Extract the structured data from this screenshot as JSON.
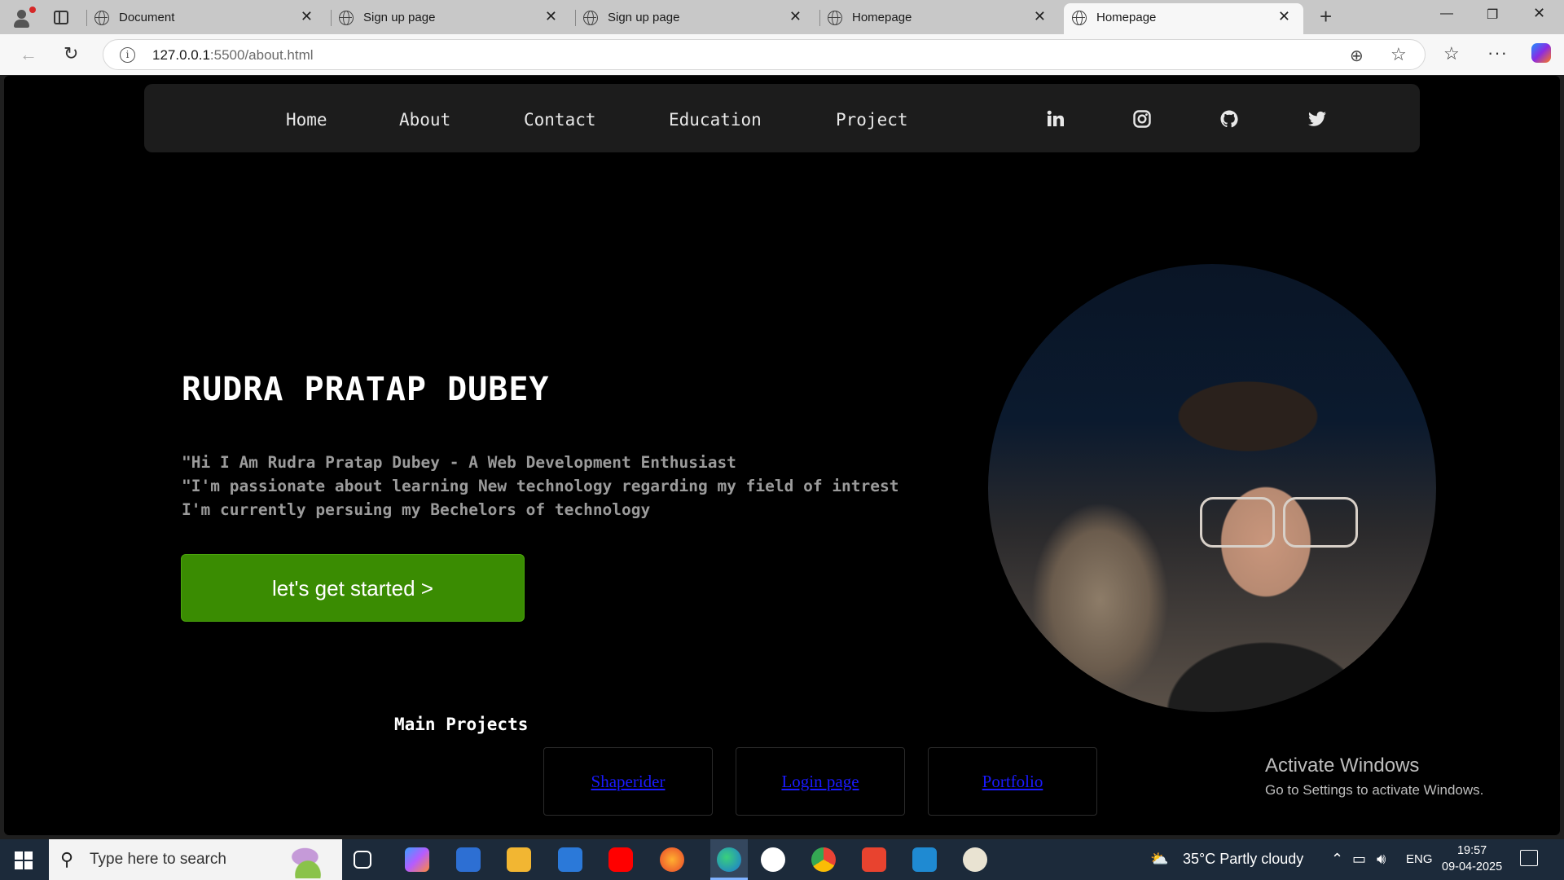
{
  "browser": {
    "tabs": [
      {
        "title": "Document",
        "active": false
      },
      {
        "title": "Sign up page",
        "active": false
      },
      {
        "title": "Sign up page",
        "active": false
      },
      {
        "title": "Homepage",
        "active": false
      },
      {
        "title": "Homepage",
        "active": true
      }
    ],
    "url_host": "127.0.0.1",
    "url_path": ":5500/about.html",
    "new_tab": "+"
  },
  "nav": {
    "links": [
      "Home",
      "About",
      "Contact",
      "Education",
      "Project"
    ],
    "social_icons": [
      "linkedin-icon",
      "instagram-icon",
      "github-icon",
      "twitter-icon"
    ]
  },
  "hero": {
    "name": "RUDRA PRATAP DUBEY",
    "lines": [
      "\"Hi I Am Rudra Pratap Dubey - A Web Development Enthusiast",
      "\"I'm passionate about learning New technology regarding my field of intrest",
      "I'm currently persuing my Bechelors of technology"
    ],
    "cta_label": "let's get started >"
  },
  "projects": {
    "title": "Main Projects",
    "items": [
      "Shaperider",
      "Login page",
      "Portfolio"
    ]
  },
  "watermark": {
    "line1": "Activate Windows",
    "line2": "Go to Settings to activate Windows."
  },
  "taskbar": {
    "search_placeholder": "Type here to search",
    "weather": "35°C  Partly cloudy",
    "language": "ENG",
    "time": "19:57",
    "date": "09-04-2025"
  },
  "colors": {
    "page_bg": "#000000",
    "nav_bg": "#1c1c1c",
    "cta_bg": "#3a8c02",
    "link_color": "#1a1aff"
  }
}
